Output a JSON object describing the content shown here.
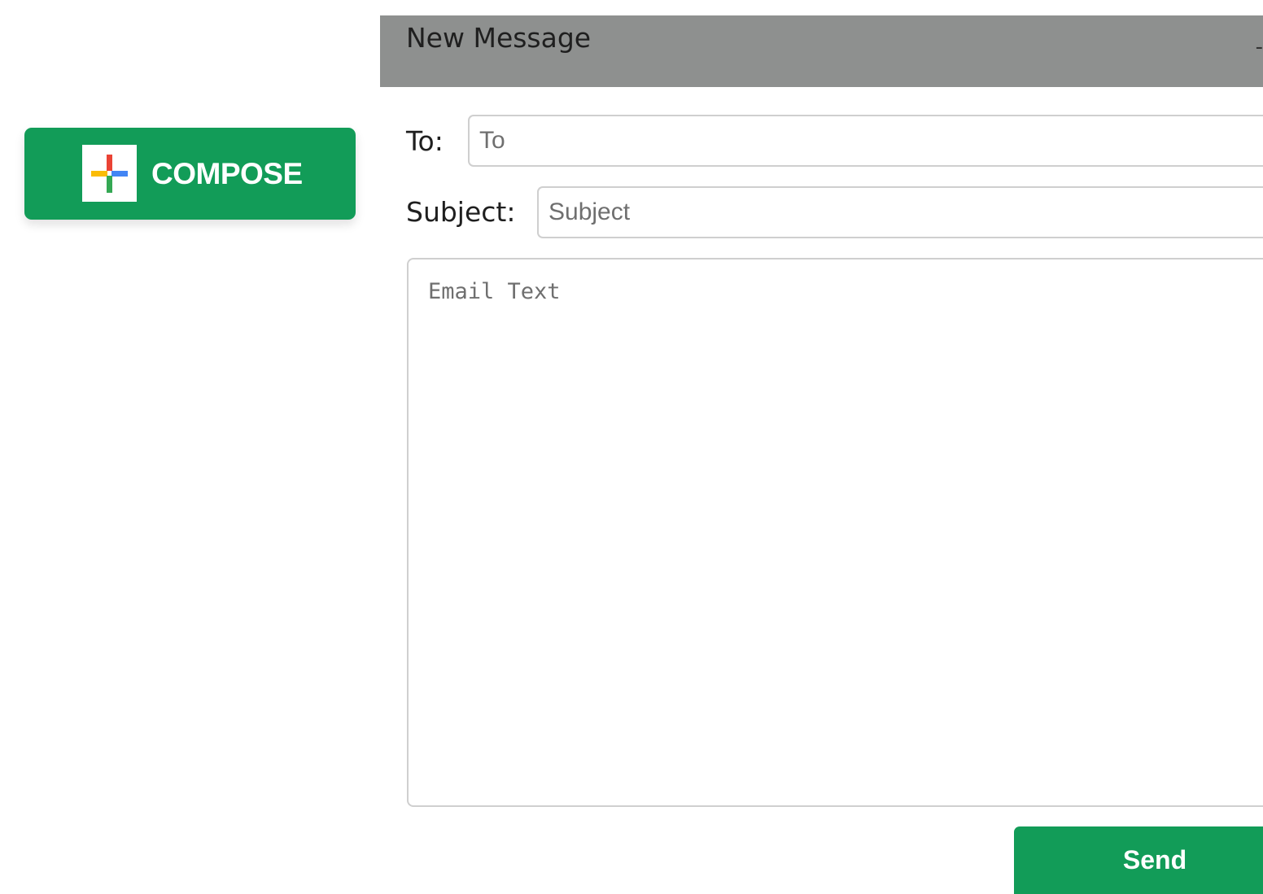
{
  "compose": {
    "label": "COMPOSE",
    "icon": "plus-icon",
    "background_color": "#129c58",
    "icon_colors": [
      "#ea4335",
      "#4285f4",
      "#fbbc05",
      "#34a853"
    ]
  },
  "message": {
    "title": "New Message",
    "header_color": "#8e908f",
    "close_glyph": "-",
    "to_label": "To:",
    "to_placeholder": "To",
    "to_value": "",
    "subject_label": "Subject:",
    "subject_placeholder": "Subject",
    "subject_value": "",
    "body_placeholder": "Email Text",
    "body_value": "",
    "send_label": "Send",
    "send_color": "#129c58"
  }
}
